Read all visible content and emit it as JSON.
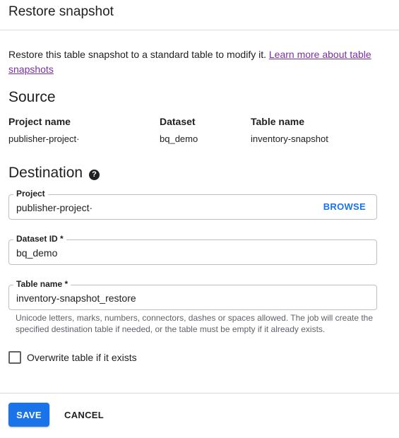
{
  "dialog": {
    "title": "Restore snapshot",
    "intro_text": "Restore this table snapshot to a standard table to modify it. ",
    "learn_more_link": "Learn more about table snapshots"
  },
  "source": {
    "title": "Source",
    "project_label": "Project name",
    "project_value": "publisher-project·",
    "dataset_label": "Dataset",
    "dataset_value": "bq_demo",
    "table_label": "Table name",
    "table_value": "inventory-snapshot"
  },
  "destination": {
    "title": "Destination",
    "help_icon": "help-icon",
    "project_label": "Project",
    "project_value": "publisher-project·",
    "browse_label": "BROWSE",
    "dataset_label": "Dataset ID *",
    "dataset_value": "bq_demo",
    "table_label": "Table name *",
    "table_value": "inventory-snapshot_restore",
    "hint": "Unicode letters, marks, numbers, connectors, dashes or spaces allowed. The job will create the specified destination table if needed, or the table must be empty if it already exists.",
    "overwrite_label": "Overwrite table if it exists",
    "overwrite_checked": false
  },
  "actions": {
    "save_label": "SAVE",
    "cancel_label": "CANCEL"
  },
  "colors": {
    "primary": "#1a73e8",
    "link": "#7b2fa3",
    "border": "#bdc1c6",
    "hint_text": "#5f6368"
  }
}
